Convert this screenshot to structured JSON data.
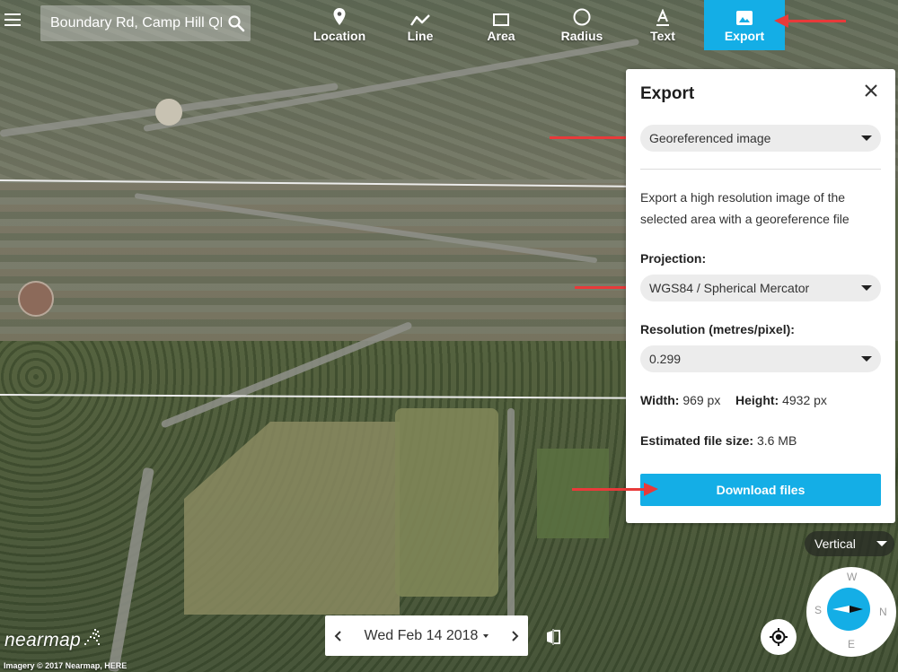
{
  "search": {
    "value": "Boundary Rd, Camp Hill QLD",
    "icon": "search-icon"
  },
  "menu": {
    "icon": "hamburger-menu-icon"
  },
  "toolbar": {
    "tools": [
      {
        "label": "Location",
        "icon": "location-pin-icon",
        "active": false
      },
      {
        "label": "Line",
        "icon": "line-icon",
        "active": false
      },
      {
        "label": "Area",
        "icon": "rectangle-area-icon",
        "active": false
      },
      {
        "label": "Radius",
        "icon": "circle-radius-icon",
        "active": false
      },
      {
        "label": "Text",
        "icon": "text-icon",
        "active": false
      },
      {
        "label": "Export",
        "icon": "image-export-icon",
        "active": true
      }
    ]
  },
  "export_panel": {
    "title": "Export",
    "close_icon": "close-icon",
    "format": {
      "selected": "Georeferenced image"
    },
    "description": "Export a high resolution image of the selected area with a georeference file",
    "projection": {
      "label": "Projection:",
      "selected": "WGS84 / Spherical Mercator"
    },
    "resolution": {
      "label": "Resolution (metres/pixel):",
      "selected": "0.299"
    },
    "width": {
      "label": "Width:",
      "value": "969 px"
    },
    "height": {
      "label": "Height:",
      "value": "4932 px"
    },
    "file_size": {
      "label": "Estimated file size:",
      "value": "3.6 MB"
    },
    "download_label": "Download files"
  },
  "view_mode": {
    "selected": "Vertical"
  },
  "compass": {
    "north": "N",
    "south": "S",
    "east": "E",
    "west": "W"
  },
  "date_nav": {
    "date": "Wed Feb 14 2018",
    "prev_icon": "chevron-left-icon",
    "next_icon": "chevron-right-icon"
  },
  "footer": {
    "logo": "nearmap",
    "attribution": "Imagery © 2017 Nearmap, HERE"
  },
  "colors": {
    "accent": "#14aee6",
    "annotation_arrow": "#e83a3a",
    "panel_bg": "#ffffff",
    "select_bg": "#ececec"
  }
}
